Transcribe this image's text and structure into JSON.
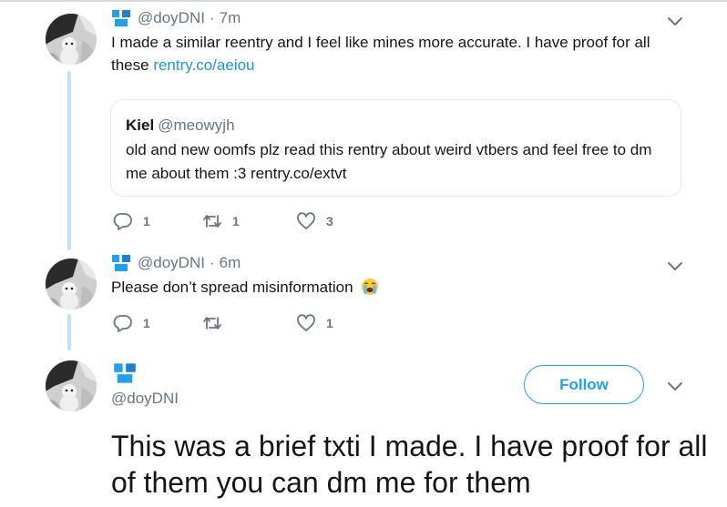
{
  "tweets": [
    {
      "handle": "@doyDNI",
      "time": "7m",
      "text": "I made a similar reentry and I feel like mines more accurate. I have proof for all these ",
      "link": "rentry.co/aeiou",
      "quote": {
        "name": "Kiel",
        "handle": "@meowyjh",
        "text": "old and new oomfs plz read this rentry about weird vtbers and feel free to dm me about them :3 rentry.co/extvt"
      },
      "replies": "1",
      "retweets": "1",
      "likes": "3"
    },
    {
      "handle": "@doyDNI",
      "time": "6m",
      "text": "Please don’t spread misinformation",
      "emoji": "loudly-crying-face",
      "replies": "1",
      "retweets": "",
      "likes": "1"
    },
    {
      "handle": "@doyDNI",
      "follow_label": "Follow",
      "text": "This was a brief txti I made. I have proof for all of them you can dm me for them"
    }
  ],
  "colors": {
    "accent": "#1da1f2",
    "link": "#1b95e0",
    "muted": "#657786",
    "thread": "#c4e0f6",
    "text": "#14171a"
  }
}
